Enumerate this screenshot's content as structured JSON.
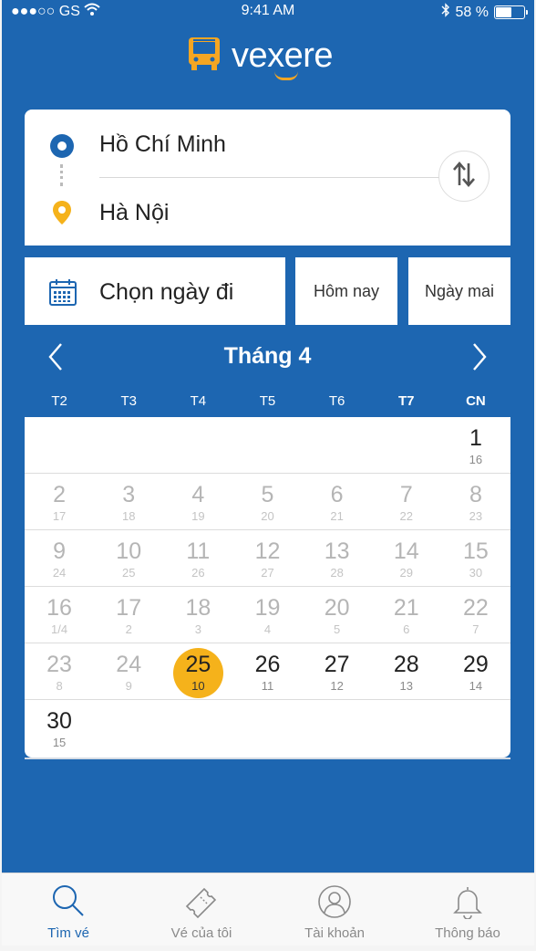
{
  "status_bar": {
    "carrier": "●●●○○ GS",
    "time": "9:41 AM",
    "battery": "58 %",
    "battery_level": 0.58
  },
  "header": {
    "logo_text": "vexere"
  },
  "route": {
    "origin": "Hồ Chí Minh",
    "destination": "Hà Nội"
  },
  "date": {
    "label": "Chọn ngày đi",
    "today": "Hôm nay",
    "tomorrow": "Ngày mai"
  },
  "calendar": {
    "month_title": "Tháng 4",
    "weekdays": [
      "T2",
      "T3",
      "T4",
      "T5",
      "T6",
      "T7",
      "CN"
    ],
    "weeks": [
      [
        null,
        null,
        null,
        null,
        null,
        null,
        {
          "d": "1",
          "l": "16",
          "state": "normal"
        }
      ],
      [
        {
          "d": "2",
          "l": "17",
          "state": "past"
        },
        {
          "d": "3",
          "l": "18",
          "state": "past"
        },
        {
          "d": "4",
          "l": "19",
          "state": "past"
        },
        {
          "d": "5",
          "l": "20",
          "state": "past"
        },
        {
          "d": "6",
          "l": "21",
          "state": "past"
        },
        {
          "d": "7",
          "l": "22",
          "state": "past"
        },
        {
          "d": "8",
          "l": "23",
          "state": "past"
        }
      ],
      [
        {
          "d": "9",
          "l": "24",
          "state": "past"
        },
        {
          "d": "10",
          "l": "25",
          "state": "past"
        },
        {
          "d": "11",
          "l": "26",
          "state": "past"
        },
        {
          "d": "12",
          "l": "27",
          "state": "past"
        },
        {
          "d": "13",
          "l": "28",
          "state": "past"
        },
        {
          "d": "14",
          "l": "29",
          "state": "past"
        },
        {
          "d": "15",
          "l": "30",
          "state": "past"
        }
      ],
      [
        {
          "d": "16",
          "l": "1/4",
          "state": "past"
        },
        {
          "d": "17",
          "l": "2",
          "state": "past"
        },
        {
          "d": "18",
          "l": "3",
          "state": "past"
        },
        {
          "d": "19",
          "l": "4",
          "state": "past"
        },
        {
          "d": "20",
          "l": "5",
          "state": "past"
        },
        {
          "d": "21",
          "l": "6",
          "state": "past"
        },
        {
          "d": "22",
          "l": "7",
          "state": "past"
        }
      ],
      [
        {
          "d": "23",
          "l": "8",
          "state": "past"
        },
        {
          "d": "24",
          "l": "9",
          "state": "past"
        },
        {
          "d": "25",
          "l": "10",
          "state": "selected"
        },
        {
          "d": "26",
          "l": "11",
          "state": "normal"
        },
        {
          "d": "27",
          "l": "12",
          "state": "normal"
        },
        {
          "d": "28",
          "l": "13",
          "state": "normal"
        },
        {
          "d": "29",
          "l": "14",
          "state": "normal"
        }
      ],
      [
        {
          "d": "30",
          "l": "15",
          "state": "normal"
        },
        null,
        null,
        null,
        null,
        null,
        null
      ]
    ]
  },
  "tabbar": {
    "items": [
      {
        "label": "Tìm vé",
        "icon": "search-icon",
        "active": true
      },
      {
        "label": "Vé của tôi",
        "icon": "ticket-icon",
        "active": false
      },
      {
        "label": "Tài khoản",
        "icon": "account-icon",
        "active": false
      },
      {
        "label": "Thông báo",
        "icon": "bell-icon",
        "active": false
      }
    ]
  },
  "colors": {
    "primary": "#1d66b1",
    "accent": "#f5b21b",
    "logo_accent": "#f5a623"
  }
}
